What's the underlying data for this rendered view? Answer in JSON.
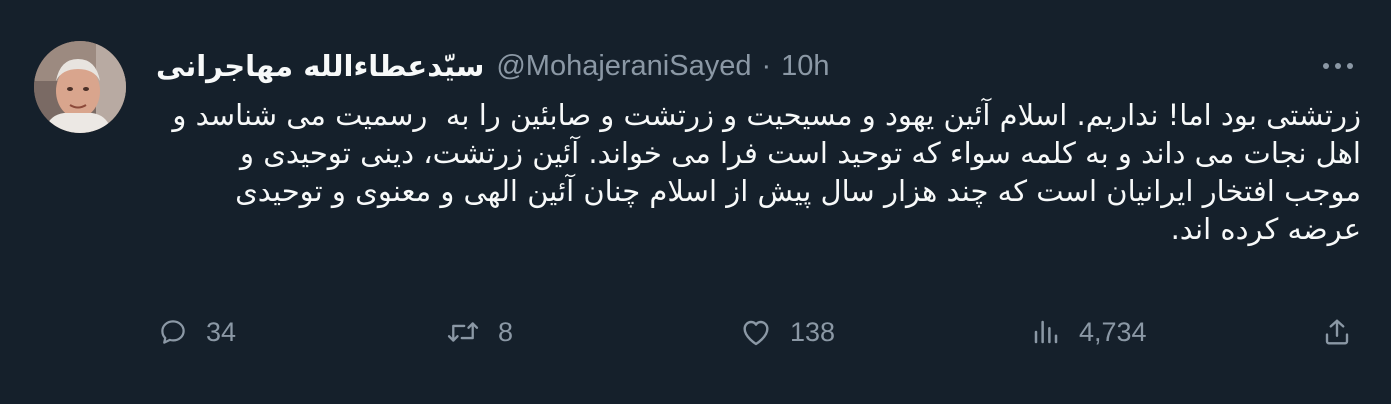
{
  "tweet": {
    "display_name": "سیّدعطاءالله مهاجرانی",
    "handle": "@MohajeraniSayed",
    "separator": "·",
    "time": "10h",
    "text": "زرتشتی بود اما! نداریم. اسلام آئین یهود و مسیحیت و زرتشت و صابئین را به  رسمیت می شناسد و اهل نجات می داند و به کلمه سواء که توحید است فرا می خواند. آئین زرتشت، دینی توحیدی و موجب افتخار ایرانیان است که چند هزار سال پیش از اسلام چنان آئین الهی و معنوی و توحیدی عرضه کرده اند."
  },
  "actions": {
    "reply": {
      "count": "34",
      "icon": "reply-icon"
    },
    "retweet": {
      "count": "8",
      "icon": "retweet-icon"
    },
    "like": {
      "count": "138",
      "icon": "heart-icon"
    },
    "views": {
      "count": "4,734",
      "icon": "views-icon"
    },
    "share": {
      "icon": "share-icon"
    }
  },
  "colors": {
    "background": "#15202b",
    "primary_text": "#f7f9f9",
    "secondary_text": "#8b98a5"
  }
}
